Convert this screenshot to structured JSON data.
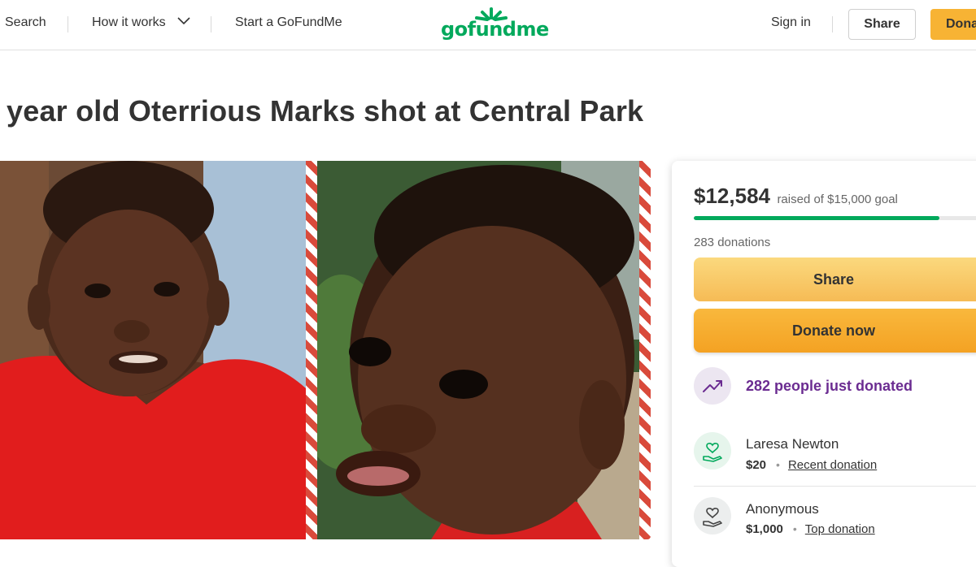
{
  "header": {
    "search_label": "Search",
    "how_it_works_label": "How it works",
    "start_label": "Start a GoFundMe",
    "logo_text": "gofundme",
    "sign_in_label": "Sign in",
    "share_label": "Share",
    "donate_label": "Donate"
  },
  "campaign": {
    "title": "year old Oterrious Marks shot at Central Park"
  },
  "card": {
    "raised_amount": "$12,584",
    "raised_text": "raised of $15,000 goal",
    "progress_fraction": 0.839,
    "donation_count": "283 donations",
    "share_label": "Share",
    "donate_label": "Donate now",
    "recent_activity": "282 people just donated",
    "donors": [
      {
        "name": "Laresa Newton",
        "amount": "$20",
        "label": "Recent donation"
      },
      {
        "name": "Anonymous",
        "amount": "$1,000",
        "label": "Top donation"
      }
    ]
  },
  "colors": {
    "brand_green": "#02a95c",
    "donate_orange": "#f7b334",
    "activity_purple": "#6b2c91"
  },
  "icons": [
    "chevron-down-icon",
    "trending-up-icon",
    "heart-hand-icon"
  ]
}
